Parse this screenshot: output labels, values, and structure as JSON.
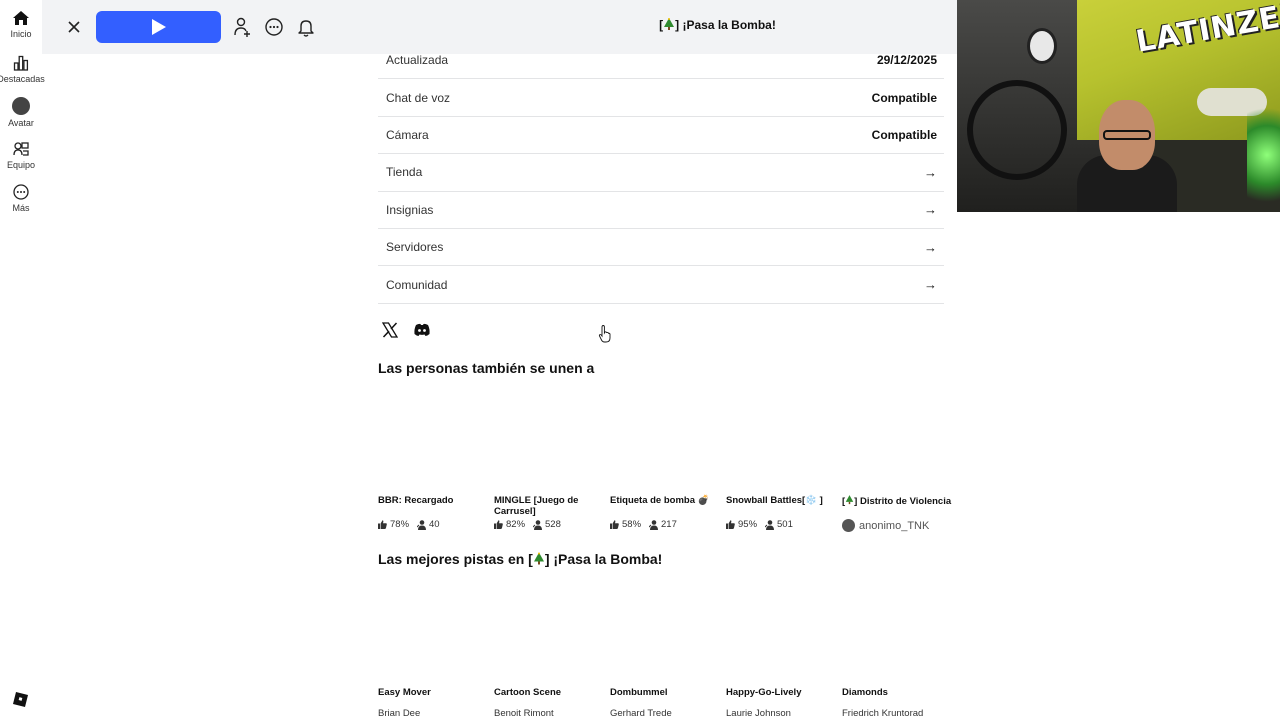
{
  "nav": {
    "items": [
      {
        "label": "Inicio",
        "icon": "home-icon"
      },
      {
        "label": "Destacadas",
        "icon": "chart-icon"
      },
      {
        "label": "Avatar",
        "icon": "avatar-icon"
      },
      {
        "label": "Equipo",
        "icon": "team-icon"
      },
      {
        "label": "Más",
        "icon": "more-icon"
      }
    ],
    "logo_icon": "roblox-logo-icon"
  },
  "topbar": {
    "title_prefix": "[",
    "title_suffix": "] ¡Pasa la Bomba!",
    "play_button_icon": "play-icon",
    "accent": "#335fff"
  },
  "info_rows": [
    {
      "label": "Actualizada",
      "value": "29/12/2025"
    },
    {
      "label": "Chat de voz",
      "value": "Compatible"
    },
    {
      "label": "Cámara",
      "value": "Compatible"
    },
    {
      "label": "Tienda",
      "value": "→"
    },
    {
      "label": "Insignias",
      "value": "→"
    },
    {
      "label": "Servidores",
      "value": "→"
    },
    {
      "label": "Comunidad",
      "value": "→"
    }
  ],
  "social": [
    "x-icon",
    "discord-icon"
  ],
  "also_join": {
    "title": "Las personas también se unen a",
    "games": [
      {
        "name": "BBR: Recargado",
        "rating": "78%",
        "players": "40"
      },
      {
        "name": "MINGLE [Juego de Carrusel]",
        "rating": "82%",
        "players": "528"
      },
      {
        "name": "Etiqueta de bomba 💣",
        "rating": "58%",
        "players": "217"
      },
      {
        "name": "Snowball Battles[❄️ ]",
        "rating": "95%",
        "players": "501"
      },
      {
        "name_prefix": "[",
        "name_suffix": "] Distrito de Violencia",
        "creator": "anonimo_TNK"
      }
    ]
  },
  "tracks": {
    "title_prefix": "Las mejores pistas en [",
    "title_suffix": "] ¡Pasa la Bomba!",
    "items": [
      {
        "name": "Easy Mover",
        "artist": "Brian Dee"
      },
      {
        "name": "Cartoon Scene",
        "artist": "Benoit Rimont"
      },
      {
        "name": "Dombummel",
        "artist": "Gerhard Trede"
      },
      {
        "name": "Happy-Go-Lively",
        "artist": "Laurie Johnson"
      },
      {
        "name": "Diamonds",
        "artist": "Friedrich Kruntorad"
      }
    ]
  },
  "webcam": {
    "overlay_text": "LATINZERO"
  }
}
